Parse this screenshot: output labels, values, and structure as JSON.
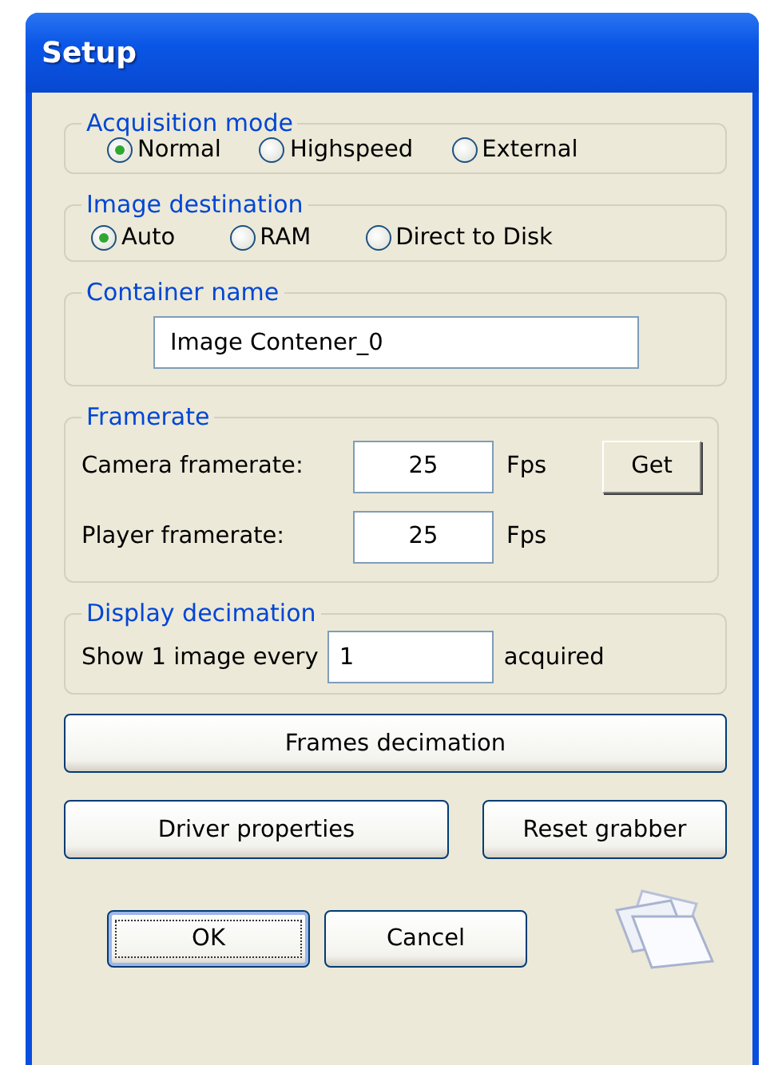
{
  "window": {
    "title": "Setup"
  },
  "acquisition_mode": {
    "label": "Acquisition mode",
    "options": [
      {
        "label": "Normal",
        "selected": true
      },
      {
        "label": "Highspeed",
        "selected": false
      },
      {
        "label": "External",
        "selected": false
      }
    ]
  },
  "image_destination": {
    "label": "Image destination",
    "options": [
      {
        "label": "Auto",
        "selected": true
      },
      {
        "label": "RAM",
        "selected": false
      },
      {
        "label": "Direct to Disk",
        "selected": false
      }
    ]
  },
  "container_name": {
    "label": "Container name",
    "value": "Image Contener_0"
  },
  "framerate": {
    "label": "Framerate",
    "rows": [
      {
        "label": "Camera framerate:",
        "value": "25",
        "unit": "Fps",
        "button": "Get"
      },
      {
        "label": "Player framerate:",
        "value": "25",
        "unit": "Fps"
      }
    ]
  },
  "display_decimation": {
    "label": "Display decimation",
    "prefix": "Show 1 image every",
    "value": "1",
    "suffix": "acquired"
  },
  "frames_decimation_button": "Frames decimation",
  "driver_properties_button": "Driver properties",
  "reset_grabber_button": "Reset grabber",
  "dialog_buttons": [
    {
      "label": "OK",
      "focused": true
    },
    {
      "label": "Cancel",
      "focused": false
    }
  ]
}
